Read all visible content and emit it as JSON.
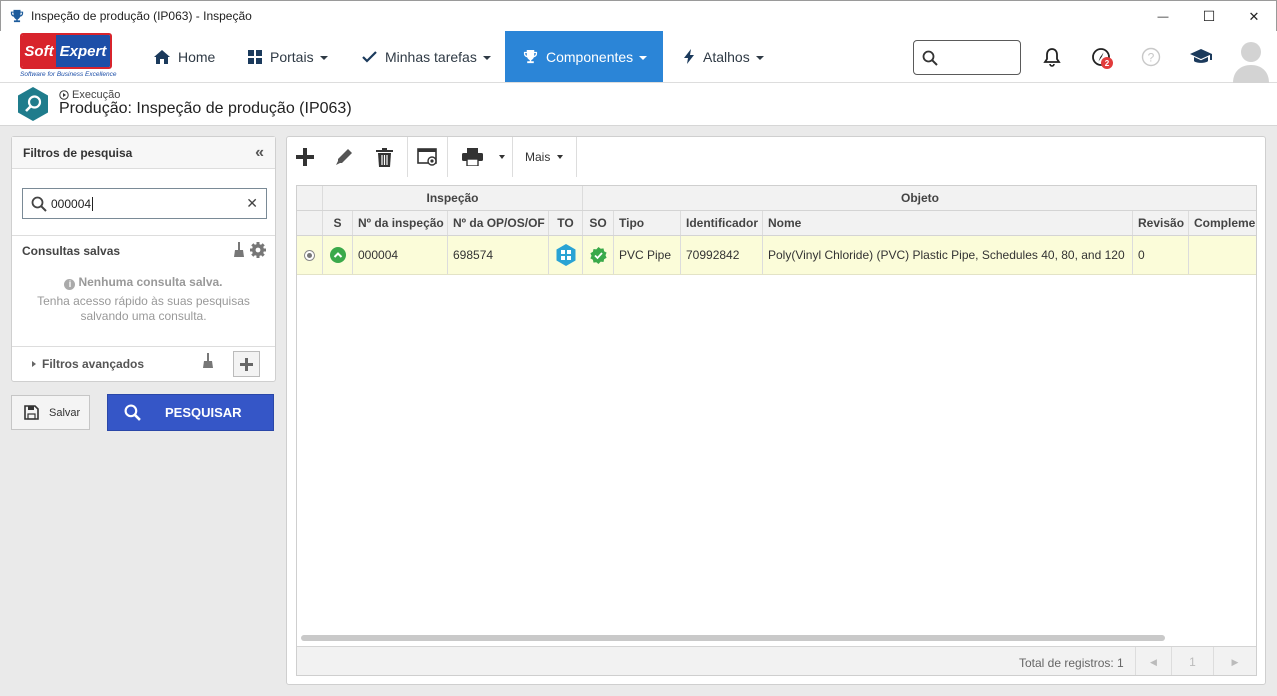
{
  "window": {
    "title": "Inspeção de produção (IP063) - Inspeção",
    "minimize_glyph": "—",
    "maximize_glyph": "☐",
    "close_glyph": "✕"
  },
  "brand": {
    "name_part1": "Soft",
    "name_part2": "Expert",
    "tagline": "Software for Business Excellence"
  },
  "nav": {
    "items": [
      {
        "label": "Home",
        "icon": "home-icon"
      },
      {
        "label": "Portais",
        "icon": "grid-icon"
      },
      {
        "label": "Minhas tarefas",
        "icon": "check-icon"
      },
      {
        "label": "Componentes",
        "icon": "trophy-icon",
        "active": true
      },
      {
        "label": "Atalhos",
        "icon": "bolt-icon"
      }
    ],
    "notification_badge": "2"
  },
  "page": {
    "breadcrumb": "Execução",
    "title": "Produção: Inspeção de produção (IP063)"
  },
  "filters": {
    "title": "Filtros de pesquisa",
    "search_value": "000004",
    "saved_title": "Consultas salvas",
    "none_saved": "Nenhuma consulta salva.",
    "none_saved_desc_line1": "Tenha acesso rápido às suas pesquisas",
    "none_saved_desc_line2": "salvando uma consulta.",
    "advanced": "Filtros avançados",
    "save_label": "Salvar",
    "search_label": "PESQUISAR"
  },
  "toolbar": {
    "more_label": "Mais"
  },
  "grid": {
    "group_headers": [
      "Inspeção",
      "Objeto"
    ],
    "columns": [
      "S",
      "Nº da inspeção",
      "Nº da OP/OS/OF",
      "TO",
      "SO",
      "Tipo",
      "Identificador",
      "Nome",
      "Revisão",
      "Complemen"
    ],
    "rows": [
      {
        "inspection": "000004",
        "order": "698574",
        "type": "PVC Pipe",
        "identifier": "70992842",
        "name": "Poly(Vinyl Chloride) (PVC) Plastic Pipe, Schedules 40, 80, and 120",
        "revision": "0",
        "complement": ""
      }
    ],
    "total_label": "Total de registros: 1",
    "page_number": "1",
    "prev_glyph": "◀",
    "next_glyph": "▶"
  },
  "colors": {
    "accent": "#2b85d7",
    "search_button": "#3556c7",
    "selected_row": "#fbfcd9",
    "status_green": "#3aa94a",
    "to_icon": "#2aa3d4",
    "brand_red": "#d8242c",
    "header_teal": "#1f7c8c"
  }
}
